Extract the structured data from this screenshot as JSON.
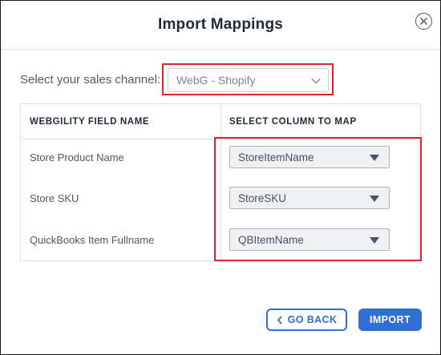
{
  "dialog": {
    "title": "Import Mappings",
    "close_icon": "circle-x-icon"
  },
  "channel": {
    "label": "Select your sales channel:",
    "selected": "WebG - Shopify",
    "icon": "chevron-down-icon"
  },
  "table": {
    "headers": [
      "WEBGILITY FIELD NAME",
      "SELECT COLUMN TO MAP"
    ],
    "rows": [
      {
        "field": "Store Product Name",
        "column": "StoreItemName"
      },
      {
        "field": "Store SKU",
        "column": "StoreSKU"
      },
      {
        "field": "QuickBooks Item Fullname",
        "column": "QBItemName"
      }
    ]
  },
  "actions": {
    "go_back": "GO BACK",
    "go_back_icon": "chevron-left-icon",
    "import": "IMPORT"
  },
  "colors": {
    "accent": "#2f6fd6",
    "highlight": "#e0232a",
    "title_text": "#1f2a36"
  }
}
